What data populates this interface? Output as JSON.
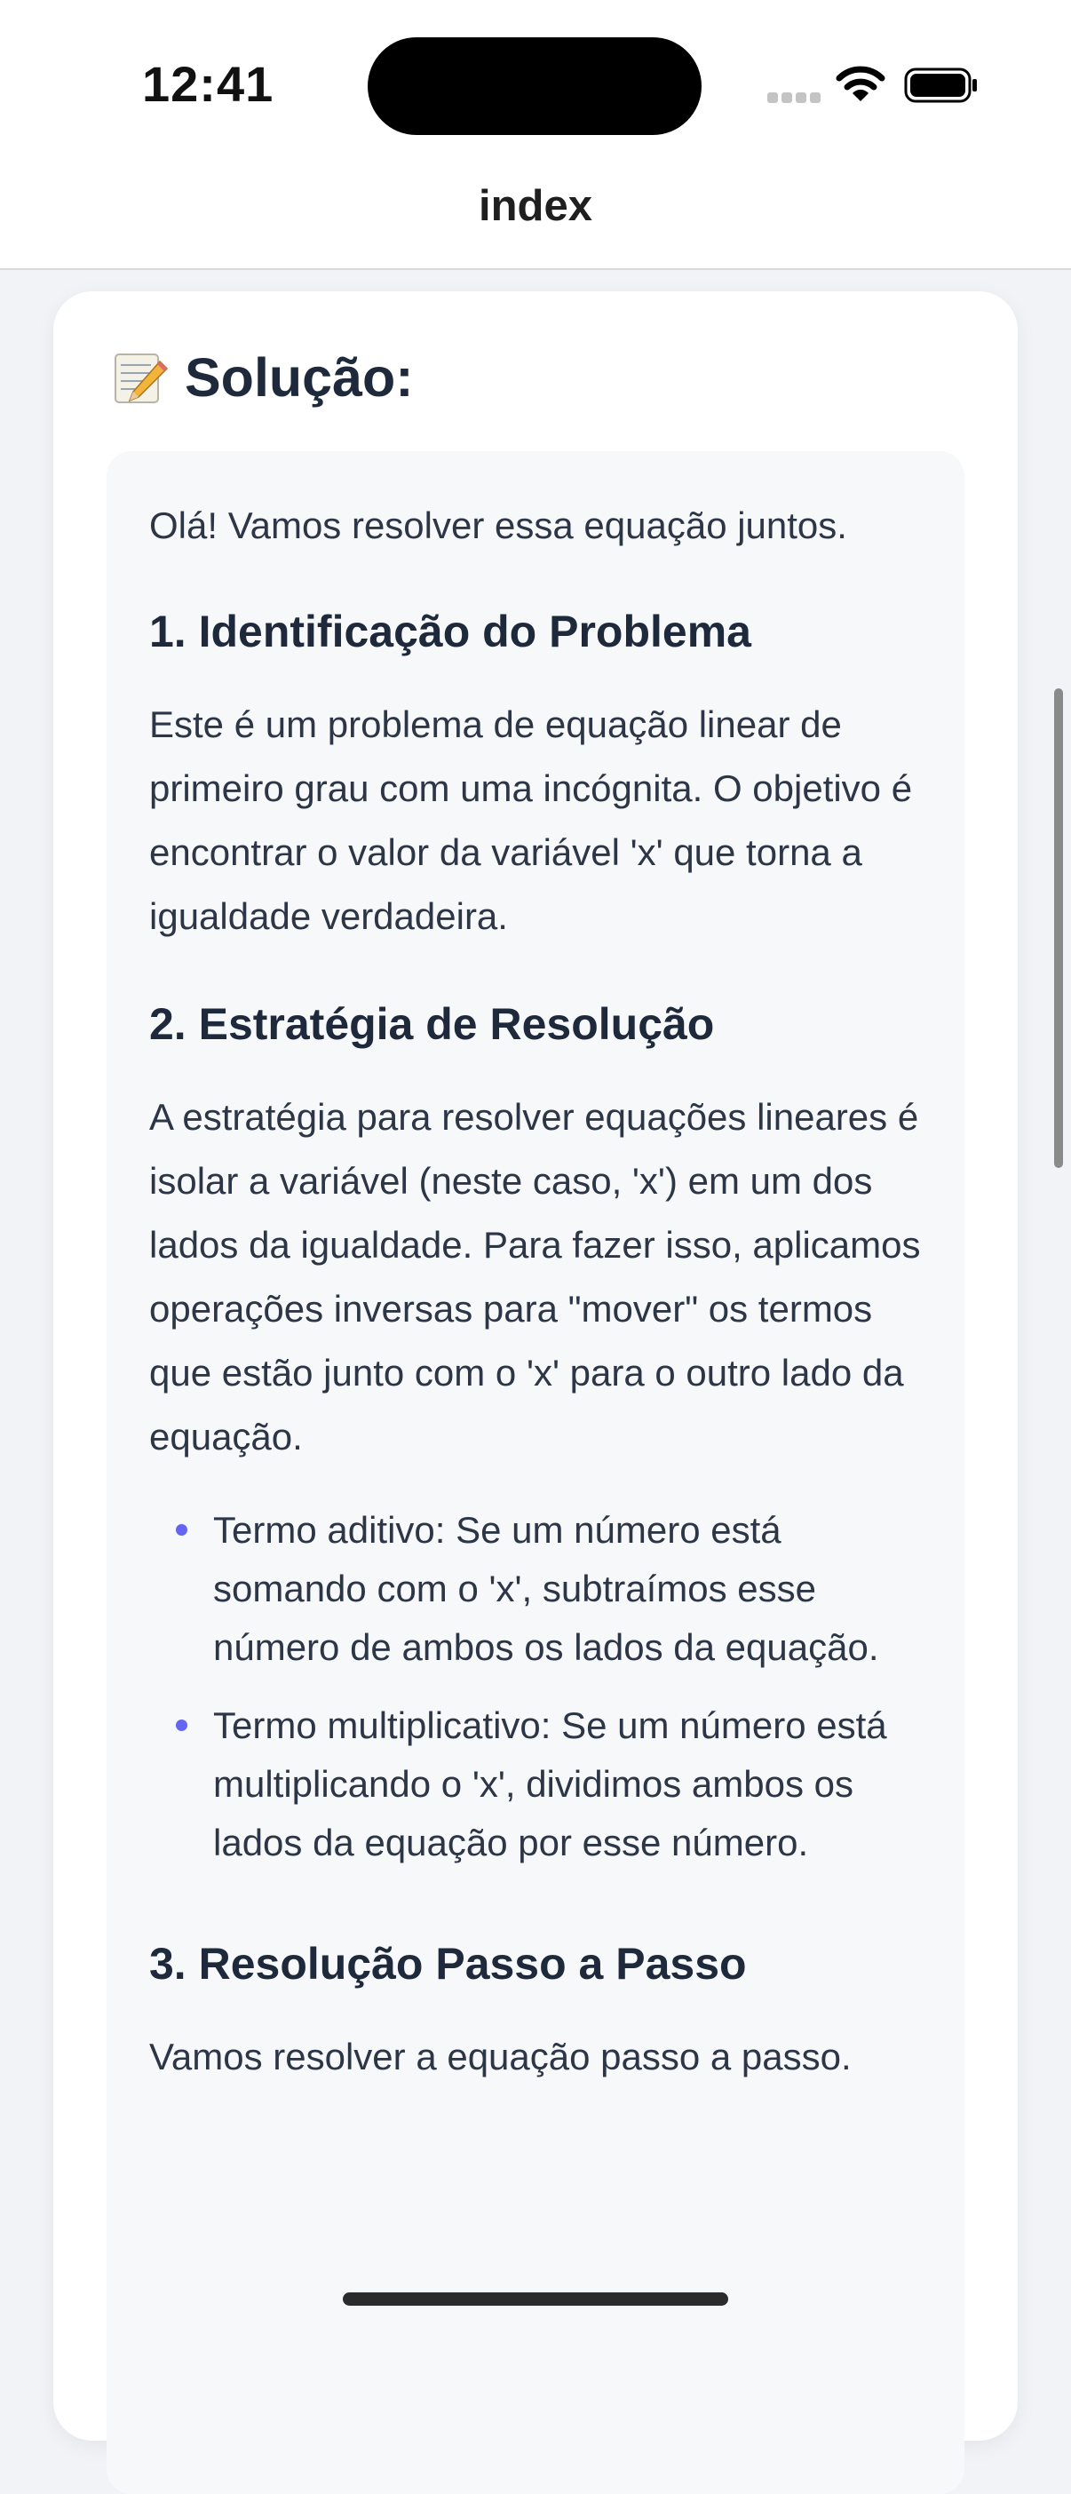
{
  "status_bar": {
    "time": "12:41",
    "icons": [
      "signal-icon",
      "wifi-icon",
      "battery-icon"
    ]
  },
  "nav": {
    "title": "index"
  },
  "card": {
    "icon": "memo-icon",
    "title": "Solução:",
    "intro": "Olá! Vamos resolver essa equação juntos.",
    "sections": {
      "s1": {
        "heading": "1. Identificação do Problema",
        "paragraph": "Este é um problema de equação linear de primeiro grau com uma incógnita. O objetivo é encontrar o valor da variável 'x' que torna a igualdade verdadeira."
      },
      "s2": {
        "heading": "2. Estratégia de Resolução",
        "paragraph": "A estratégia para resolver equações lineares é isolar a variável (neste caso, 'x') em um dos lados da igualdade. Para fazer isso, aplicamos operações inversas para \"mover\" os termos que estão junto com o 'x' para o outro lado da equação.",
        "bullets": [
          "Termo aditivo: Se um número está somando com o 'x', subtraímos esse número de ambos os lados da equação.",
          "Termo multiplicativo: Se um número está multiplicando o 'x', dividimos ambos os lados da equação por esse número."
        ]
      },
      "s3": {
        "heading": "3. Resolução Passo a Passo",
        "paragraph": "Vamos resolver a equação passo a passo."
      }
    }
  },
  "colors": {
    "background": "#f1f3f6",
    "card": "#ffffff",
    "answer_box": "#f7f8fa",
    "bullet": "#6466f1",
    "heading_text": "#1e2a3b",
    "body_text": "#2c3646"
  }
}
